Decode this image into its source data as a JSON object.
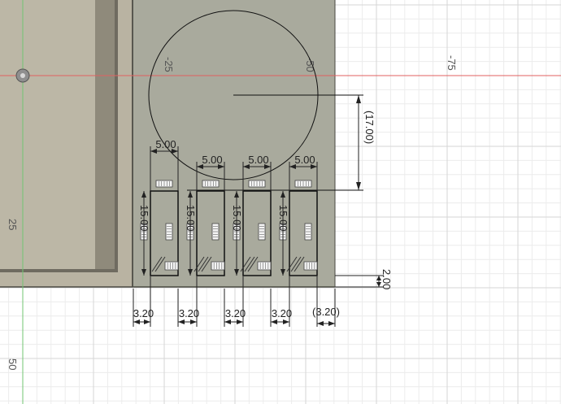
{
  "viewport": {
    "colors": {
      "background": "#ffffff",
      "grid_minor": "#ececec",
      "grid_major": "#d6d6d6",
      "x_axis": "#e06060",
      "y_axis": "#72c472",
      "body_left": "#b7b19f",
      "body_right": "#a8a99c",
      "sketch_line": "#111111",
      "dimension": "#222222"
    },
    "axis_labels": {
      "neg25": "-25",
      "neg50": "-50",
      "neg75": "-75",
      "pos25": "25",
      "pos50": "50"
    }
  },
  "sketch": {
    "circle_dim": "(17.00)",
    "slot_widths": [
      "5.00",
      "5.00",
      "5.00",
      "5.00"
    ],
    "slot_heights": [
      "15.00",
      "15.00",
      "15.00",
      "15.00"
    ],
    "gaps": [
      "3.20",
      "3.20",
      "3.20",
      "3.20"
    ],
    "last_gap": "(3.20)",
    "bottom_offset": "2.00"
  }
}
